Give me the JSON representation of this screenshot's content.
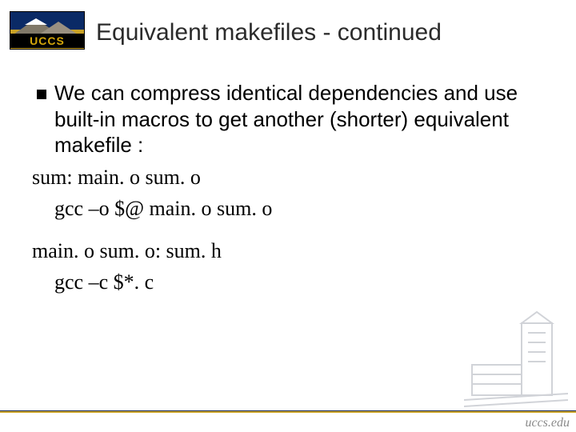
{
  "logo": {
    "text": "UCCS"
  },
  "title": "Equivalent makefiles - continued",
  "bullet": "We can compress identical dependencies and use built-in macros to get another (shorter) equivalent makefile :",
  "code": {
    "line1": "sum: main. o sum. o",
    "line2": "gcc –o $@ main. o sum. o",
    "line3": "main. o sum. o: sum. h",
    "line4": "gcc –c $*. c"
  },
  "footer": {
    "brand": "uccs.edu"
  }
}
